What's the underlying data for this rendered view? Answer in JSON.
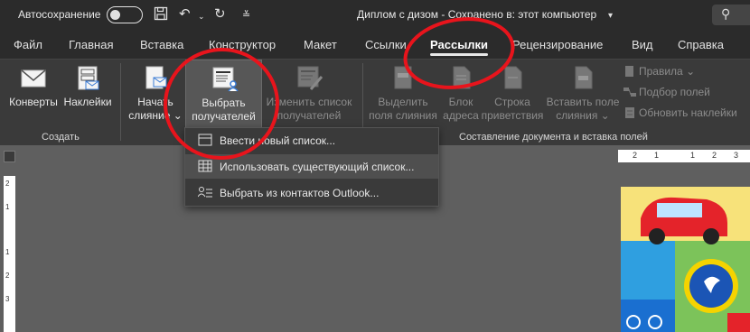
{
  "titlebar": {
    "autosave_label": "Автосохранение",
    "document_title": "Диплом с дизом - Сохранено в: этот компьютер"
  },
  "tabs": [
    {
      "label": "Файл"
    },
    {
      "label": "Главная"
    },
    {
      "label": "Вставка"
    },
    {
      "label": "Конструктор"
    },
    {
      "label": "Макет"
    },
    {
      "label": "Ссылки"
    },
    {
      "label": "Рассылки"
    },
    {
      "label": "Рецензирование"
    },
    {
      "label": "Вид"
    },
    {
      "label": "Справка"
    }
  ],
  "ribbon": {
    "create_group": {
      "label": "Создать",
      "envelopes": "Конверты",
      "labels": "Наклейки"
    },
    "merge_group": {
      "start_line1": "Начать",
      "start_line2": "слияние",
      "select_line1": "Выбрать",
      "select_line2": "получателей",
      "edit_line1": "Изменить список",
      "edit_line2": "получателей"
    },
    "compose_group": {
      "label": "Составление документа и вставка полей",
      "highlight_line1": "Выделить",
      "highlight_line2": "поля слияния",
      "address_line1": "Блок",
      "address_line2": "адреса",
      "greeting_line1": "Строка",
      "greeting_line2": "приветствия",
      "insert_line1": "Вставить поле",
      "insert_line2": "слияния",
      "rules": "Правила",
      "match_fields": "Подбор полей",
      "update_labels": "Обновить наклейки"
    }
  },
  "dropdown": {
    "items": [
      {
        "label": "Ввести новый список..."
      },
      {
        "label": "Использовать существующий список..."
      },
      {
        "label": "Выбрать из контактов Outlook..."
      }
    ]
  },
  "ruler": {
    "h_ticks": [
      "2",
      "1",
      "1",
      "2",
      "3"
    ],
    "v_ticks": [
      "2",
      "1",
      "1",
      "2",
      "3"
    ]
  },
  "colors": {
    "annotation": "#e8141c",
    "titlebar": "#2b2b2b",
    "ribbon": "#3a3a3a"
  }
}
